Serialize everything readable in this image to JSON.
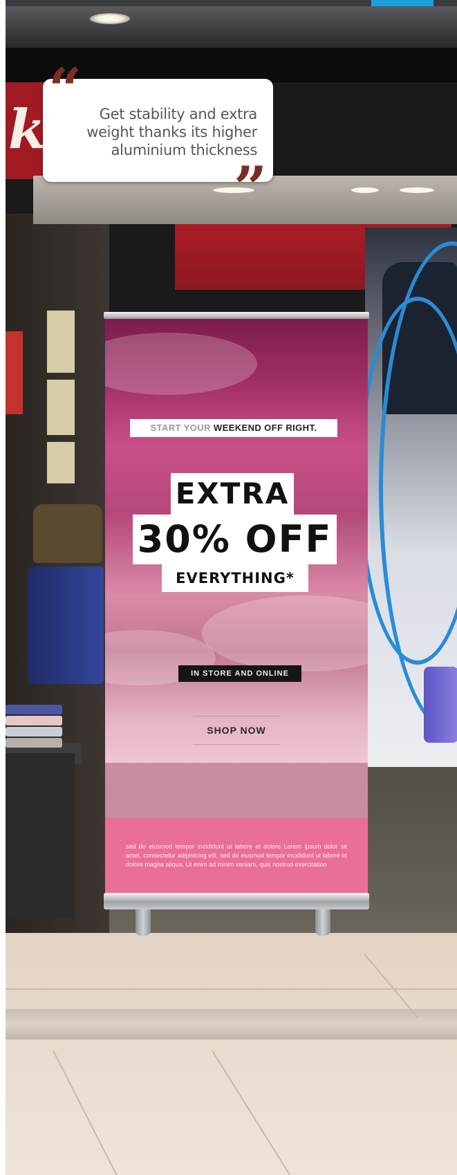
{
  "quote": {
    "text": "Get stability and extra weight thanks its higher aluminium thickness",
    "open_mark": "“",
    "close_mark": "”"
  },
  "banner": {
    "line_start_light": "START YOUR ",
    "line_start_bold": "WEEKEND OFF RIGHT.",
    "line_extra": "EXTRA",
    "line_offer": "30% OFF",
    "line_everything": "EVERYTHING*",
    "line_channel": "IN STORE AND ONLINE",
    "shop_button": "SHOP NOW",
    "body_text": "sed do eiusmod tempor incididunt ut labore et dolore Lorem ipsum dolor sit amet, consectetur adipisicing elit, sed do eiusmod tempor incididunt ut labore et dolore magna aliqua. Ut enim ad minim veniam, quis nostrud exercitation"
  },
  "colors": {
    "top_bar": "#3a3b3e",
    "top_bar_accent": "#1aa0dc",
    "quote_mark": "#7d2e20",
    "banner_pink": "#ea6f95"
  }
}
